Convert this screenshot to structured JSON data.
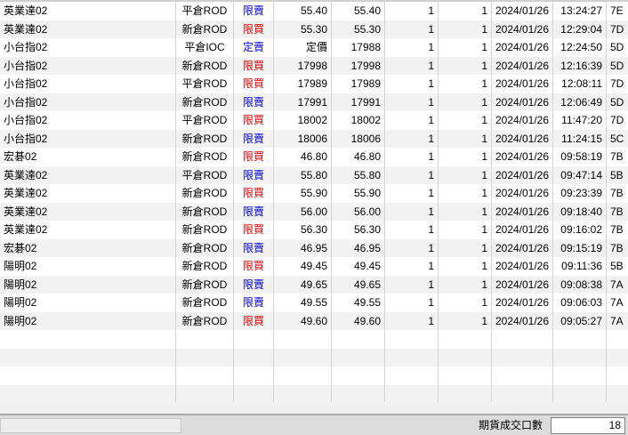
{
  "rows": [
    {
      "name": "英業達02",
      "type": "平倉ROD",
      "side": "限賣",
      "dir": "sell",
      "price": "55.40",
      "fill": "55.40",
      "q1": "1",
      "q2": "1",
      "date": "2024/01/26",
      "time": "13:24:27",
      "code": "7E"
    },
    {
      "name": "英業達02",
      "type": "新倉ROD",
      "side": "限買",
      "dir": "buy",
      "price": "55.30",
      "fill": "55.30",
      "q1": "1",
      "q2": "1",
      "date": "2024/01/26",
      "time": "12:29:04",
      "code": "7D"
    },
    {
      "name": "小台指02",
      "type": "平倉IOC",
      "side": "定賣",
      "dir": "sell",
      "price": "定價",
      "fill": "17988",
      "q1": "1",
      "q2": "1",
      "date": "2024/01/26",
      "time": "12:24:50",
      "code": "5D"
    },
    {
      "name": "小台指02",
      "type": "新倉ROD",
      "side": "限買",
      "dir": "buy",
      "price": "17998",
      "fill": "17998",
      "q1": "1",
      "q2": "1",
      "date": "2024/01/26",
      "time": "12:16:39",
      "code": "5D"
    },
    {
      "name": "小台指02",
      "type": "平倉ROD",
      "side": "限買",
      "dir": "buy",
      "price": "17989",
      "fill": "17989",
      "q1": "1",
      "q2": "1",
      "date": "2024/01/26",
      "time": "12:08:11",
      "code": "7D"
    },
    {
      "name": "小台指02",
      "type": "新倉ROD",
      "side": "限賣",
      "dir": "sell",
      "price": "17991",
      "fill": "17991",
      "q1": "1",
      "q2": "1",
      "date": "2024/01/26",
      "time": "12:06:49",
      "code": "5D"
    },
    {
      "name": "小台指02",
      "type": "平倉ROD",
      "side": "限買",
      "dir": "buy",
      "price": "18002",
      "fill": "18002",
      "q1": "1",
      "q2": "1",
      "date": "2024/01/26",
      "time": "11:47:20",
      "code": "7D"
    },
    {
      "name": "小台指02",
      "type": "新倉ROD",
      "side": "限賣",
      "dir": "sell",
      "price": "18006",
      "fill": "18006",
      "q1": "1",
      "q2": "1",
      "date": "2024/01/26",
      "time": "11:24:15",
      "code": "5C"
    },
    {
      "name": "宏碁02",
      "type": "新倉ROD",
      "side": "限買",
      "dir": "buy",
      "price": "46.80",
      "fill": "46.80",
      "q1": "1",
      "q2": "1",
      "date": "2024/01/26",
      "time": "09:58:19",
      "code": "7B"
    },
    {
      "name": "英業達02",
      "type": "平倉ROD",
      "side": "限賣",
      "dir": "sell",
      "price": "55.80",
      "fill": "55.80",
      "q1": "1",
      "q2": "1",
      "date": "2024/01/26",
      "time": "09:47:14",
      "code": "5B"
    },
    {
      "name": "英業達02",
      "type": "新倉ROD",
      "side": "限買",
      "dir": "buy",
      "price": "55.90",
      "fill": "55.90",
      "q1": "1",
      "q2": "1",
      "date": "2024/01/26",
      "time": "09:23:39",
      "code": "7B"
    },
    {
      "name": "英業達02",
      "type": "新倉ROD",
      "side": "限賣",
      "dir": "sell",
      "price": "56.00",
      "fill": "56.00",
      "q1": "1",
      "q2": "1",
      "date": "2024/01/26",
      "time": "09:18:40",
      "code": "7B"
    },
    {
      "name": "英業達02",
      "type": "新倉ROD",
      "side": "限買",
      "dir": "buy",
      "price": "56.30",
      "fill": "56.30",
      "q1": "1",
      "q2": "1",
      "date": "2024/01/26",
      "time": "09:16:02",
      "code": "7B"
    },
    {
      "name": "宏碁02",
      "type": "新倉ROD",
      "side": "限賣",
      "dir": "sell",
      "price": "46.95",
      "fill": "46.95",
      "q1": "1",
      "q2": "1",
      "date": "2024/01/26",
      "time": "09:15:19",
      "code": "7B"
    },
    {
      "name": "陽明02",
      "type": "新倉ROD",
      "side": "限買",
      "dir": "buy",
      "price": "49.45",
      "fill": "49.45",
      "q1": "1",
      "q2": "1",
      "date": "2024/01/26",
      "time": "09:11:36",
      "code": "5B"
    },
    {
      "name": "陽明02",
      "type": "新倉ROD",
      "side": "限賣",
      "dir": "sell",
      "price": "49.65",
      "fill": "49.65",
      "q1": "1",
      "q2": "1",
      "date": "2024/01/26",
      "time": "09:08:38",
      "code": "7A"
    },
    {
      "name": "陽明02",
      "type": "新倉ROD",
      "side": "限賣",
      "dir": "sell",
      "price": "49.55",
      "fill": "49.55",
      "q1": "1",
      "q2": "1",
      "date": "2024/01/26",
      "time": "09:06:03",
      "code": "7A"
    },
    {
      "name": "陽明02",
      "type": "新倉ROD",
      "side": "限買",
      "dir": "buy",
      "price": "49.60",
      "fill": "49.60",
      "q1": "1",
      "q2": "1",
      "date": "2024/01/26",
      "time": "09:05:27",
      "code": "7A"
    }
  ],
  "empty_rows": 4,
  "footer": {
    "count_label": "期貨成交口數",
    "count_value": "18"
  },
  "colors": {
    "buy": "#e00000",
    "sell": "#0000d0"
  }
}
